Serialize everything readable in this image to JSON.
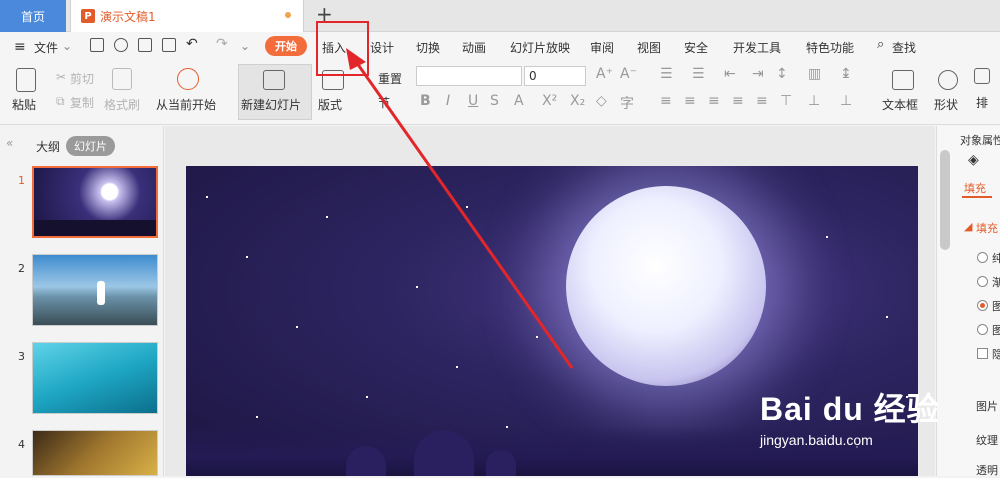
{
  "tabs": {
    "home": "首页",
    "doc": "演示文稿1",
    "new_tab": "+"
  },
  "menu": {
    "file": "文件",
    "start": "开始",
    "items": [
      "插入",
      "设计",
      "切换",
      "动画",
      "幻灯片放映",
      "审阅",
      "视图",
      "安全",
      "开发工具",
      "特色功能"
    ],
    "search": "查找"
  },
  "ribbon": {
    "paste": "粘贴",
    "cut": "剪切",
    "copy": "复制",
    "format_painter": "格式刷",
    "from_current": "从当前开始",
    "new_slide": "新建幻灯片",
    "layout": "版式",
    "reset": "重置",
    "section": "节",
    "font_size": "0",
    "text_box": "文本框",
    "shape": "形状",
    "arrange": "排"
  },
  "left_panel": {
    "outline": "大纲",
    "slides": "幻灯片",
    "thumb_numbers": [
      "1",
      "2",
      "3",
      "4"
    ]
  },
  "right_panel": {
    "title": "对象属性",
    "fill_tab": "填充",
    "fill_section": "填充",
    "opt1": "纯",
    "opt2": "渐",
    "opt3": "图",
    "opt4": "图",
    "opt5": "隐",
    "pic": "图片",
    "texture": "纹理",
    "transparency": "透明"
  },
  "watermark": {
    "brand": "Bai du 经验",
    "url": "jingyan.baidu.com"
  },
  "colors": {
    "accent": "#f36d3c",
    "home_tab": "#4a89dc",
    "highlight": "#e2262a"
  }
}
